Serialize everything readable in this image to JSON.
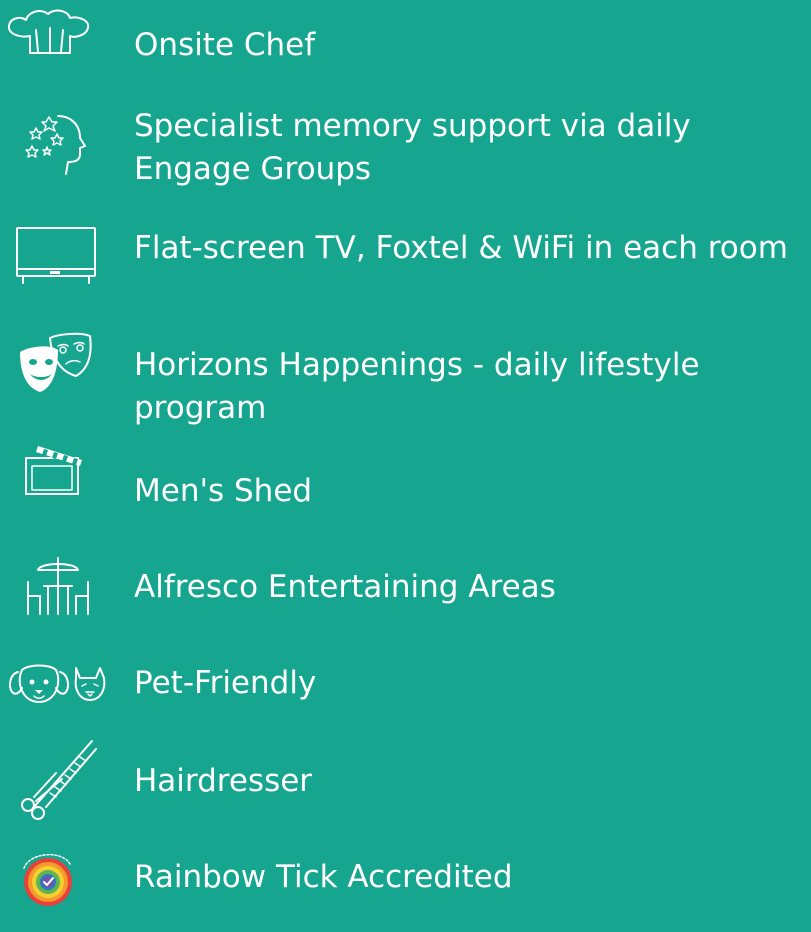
{
  "features": [
    {
      "icon": "chef-hat-icon",
      "label": "Onsite Chef"
    },
    {
      "icon": "memory-head-icon",
      "label": "Specialist memory support via daily Engage Groups"
    },
    {
      "icon": "tv-icon",
      "label": "Flat-screen TV, Foxtel & WiFi in each room"
    },
    {
      "icon": "theatre-masks-icon",
      "label": "Horizons Happenings - daily lifestyle program"
    },
    {
      "icon": "clapperboard-icon",
      "label": "Men's Shed"
    },
    {
      "icon": "outdoor-table-umbrella-icon",
      "label": "Alfresco Entertaining Areas"
    },
    {
      "icon": "dog-cat-icon",
      "label": "Pet-Friendly"
    },
    {
      "icon": "scissors-comb-icon",
      "label": "Hairdresser"
    },
    {
      "icon": "rainbow-tick-badge-icon",
      "label": "Rainbow Tick Accredited"
    }
  ],
  "colors": {
    "background": "#16a58f",
    "text": "#ffffff"
  }
}
